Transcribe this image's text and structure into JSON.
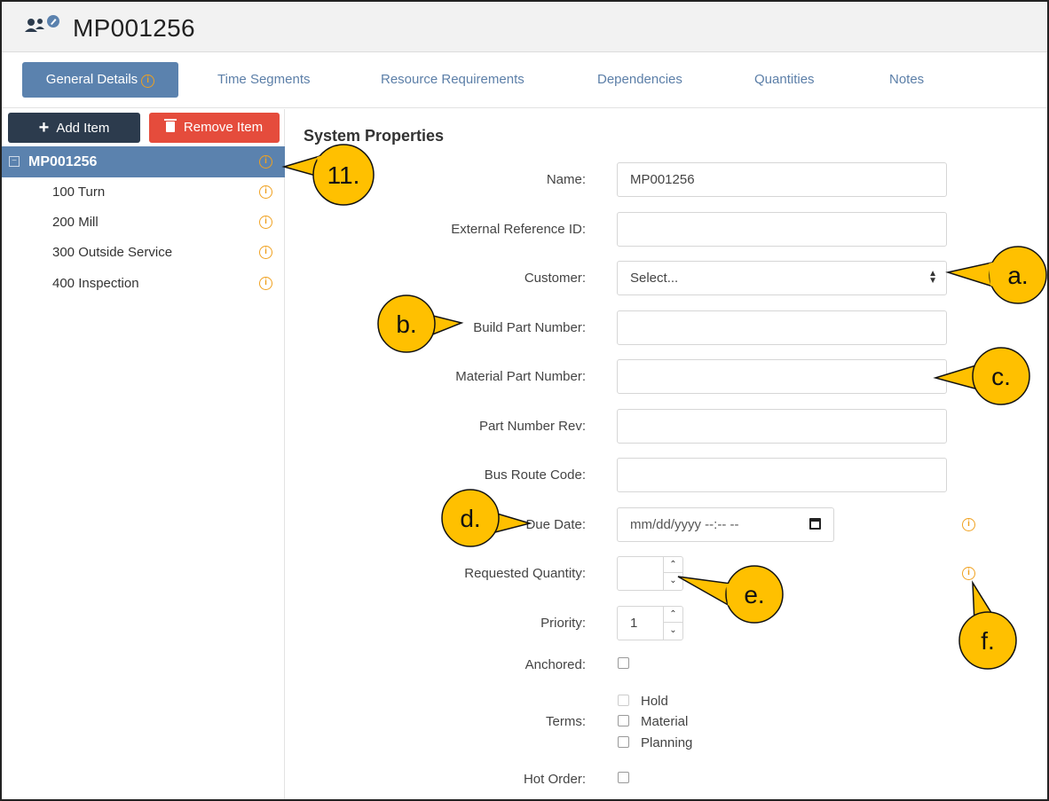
{
  "header": {
    "title": "MP001256",
    "icon": "users-edit-icon"
  },
  "tabs": [
    {
      "label": "General Details",
      "active": true
    },
    {
      "label": "Time Segments"
    },
    {
      "label": "Resource Requirements"
    },
    {
      "label": "Dependencies"
    },
    {
      "label": "Quantities"
    },
    {
      "label": "Notes"
    }
  ],
  "toolbar": {
    "add_label": "Add Item",
    "remove_label": "Remove Item"
  },
  "tree": {
    "root": {
      "label": "MP001256",
      "selected": true
    },
    "items": [
      {
        "label": "100 Turn"
      },
      {
        "label": "200 Mill"
      },
      {
        "label": "300 Outside Service"
      },
      {
        "label": "400 Inspection"
      }
    ]
  },
  "form": {
    "section_title": "System Properties",
    "name": {
      "label": "Name:",
      "value": "MP001256"
    },
    "external_ref": {
      "label": "External Reference ID:",
      "value": ""
    },
    "customer": {
      "label": "Customer:",
      "value": "Select..."
    },
    "build_part": {
      "label": "Build Part Number:",
      "value": ""
    },
    "material_part": {
      "label": "Material Part Number:",
      "value": ""
    },
    "part_rev": {
      "label": "Part Number Rev:",
      "value": ""
    },
    "bus_route": {
      "label": "Bus Route Code:",
      "value": ""
    },
    "due_date": {
      "label": "Due Date:",
      "placeholder": "mm/dd/yyyy --:-- --"
    },
    "requested_qty": {
      "label": "Requested Quantity:",
      "value": ""
    },
    "priority": {
      "label": "Priority:",
      "value": "1"
    },
    "anchored": {
      "label": "Anchored:",
      "checked": false
    },
    "terms": {
      "label": "Terms:",
      "options": [
        {
          "label": "Hold",
          "checked": false,
          "disabled": true
        },
        {
          "label": "Material",
          "checked": false
        },
        {
          "label": "Planning",
          "checked": false
        }
      ]
    },
    "hot_order": {
      "label": "Hot Order:",
      "checked": false
    }
  },
  "callouts": {
    "c11": "11.",
    "a": "a.",
    "b": "b.",
    "c": "c.",
    "d": "d.",
    "e": "e.",
    "f": "f."
  },
  "colors": {
    "accent": "#5b82ae",
    "dark_button": "#2c3b4d",
    "danger_button": "#e54c3c",
    "info": "#f0a11f",
    "callout_fill": "#ffc000"
  }
}
